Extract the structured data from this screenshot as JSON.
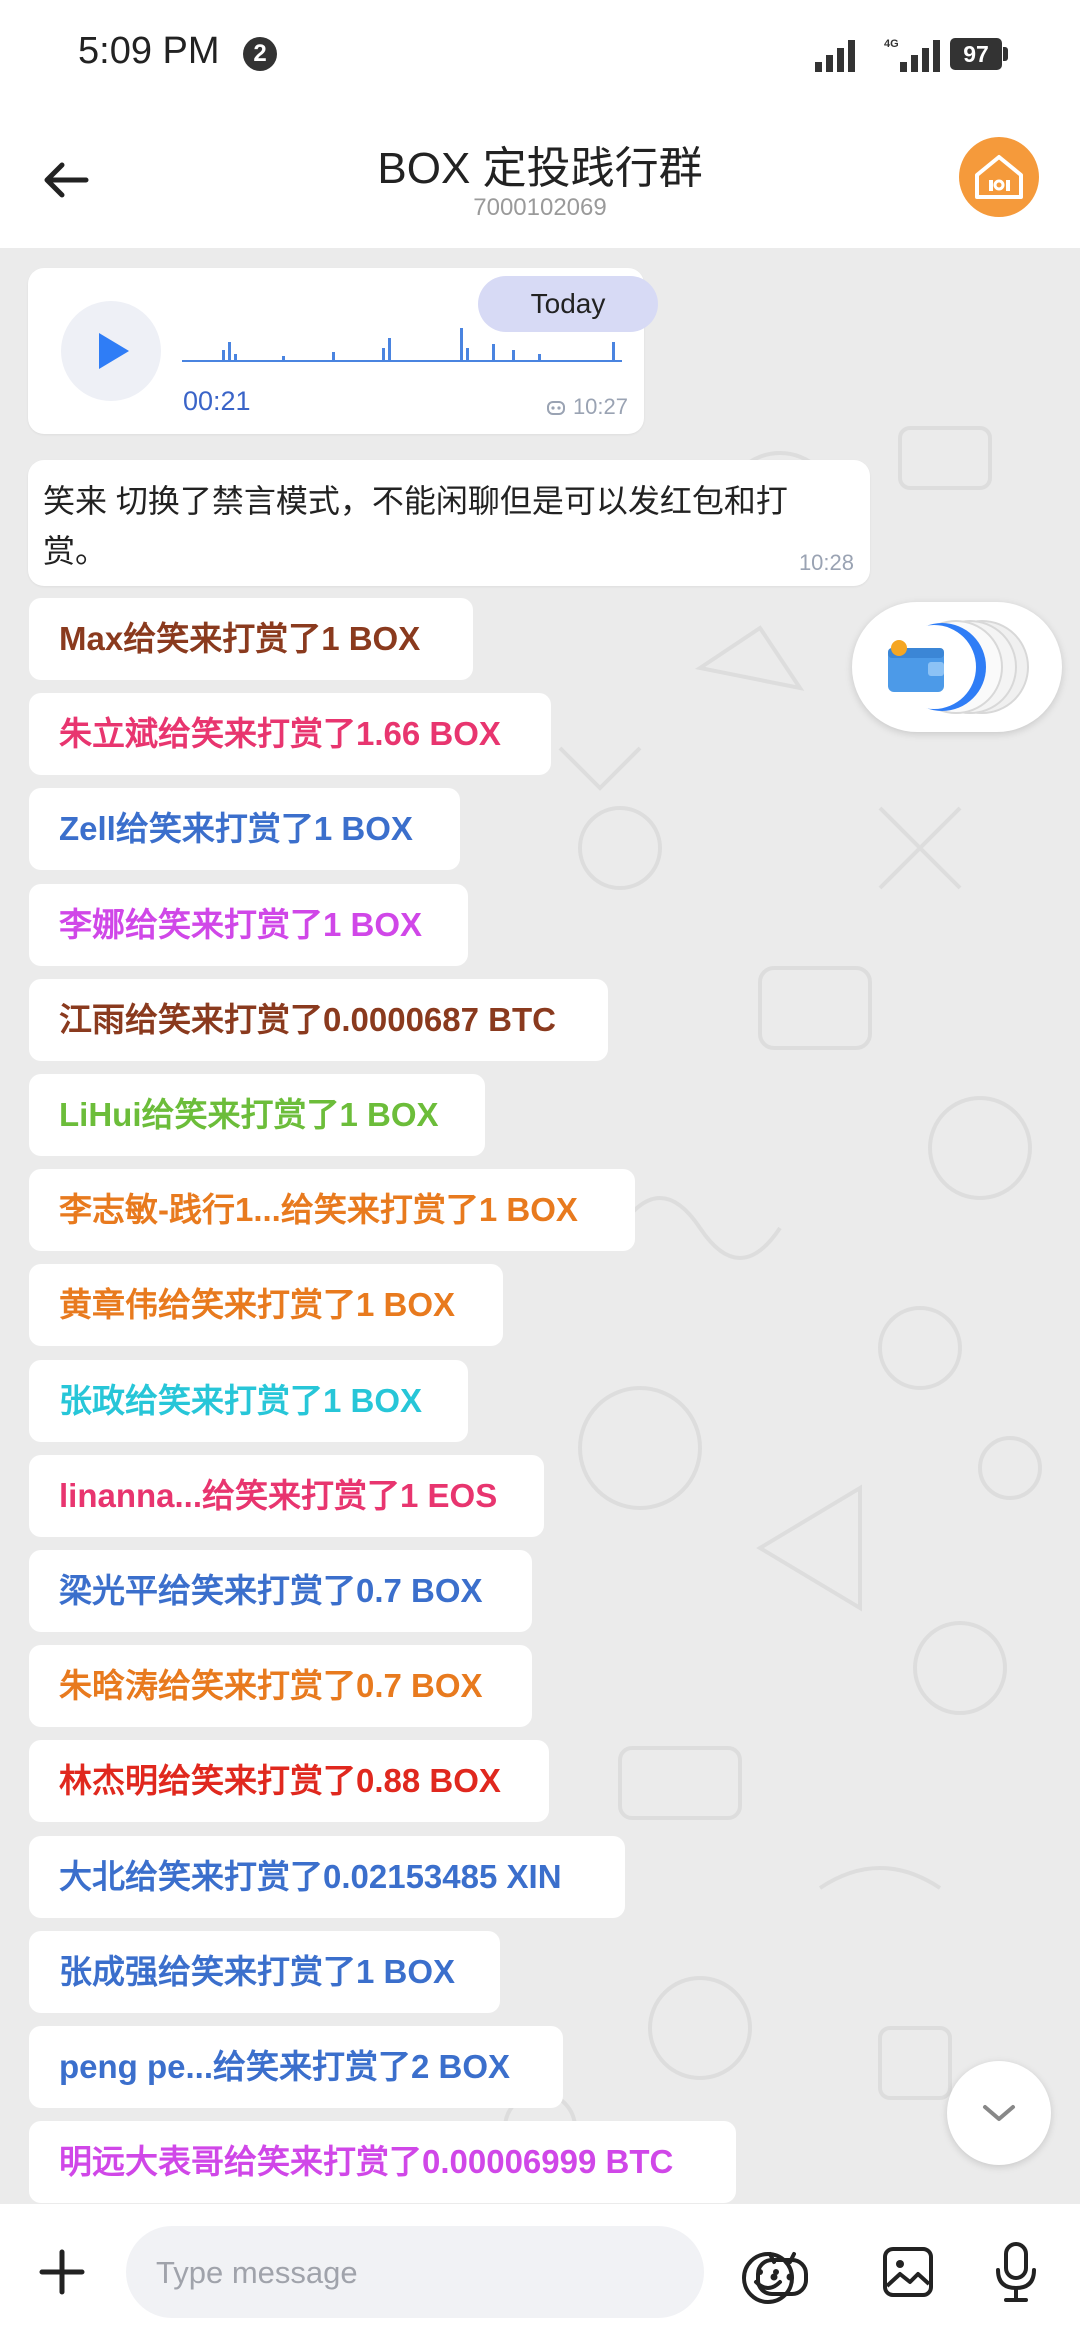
{
  "status_bar": {
    "time": "5:09 PM",
    "notification_count": "2",
    "network_label": "4G",
    "battery": "97"
  },
  "header": {
    "title": "BOX 定投践行群",
    "chat_id": "7000102069",
    "back_icon": "arrow-left-icon",
    "avatar_icon": "home-icon"
  },
  "voice_message": {
    "duration": "00:21",
    "time": "10:27",
    "date_pill": "Today"
  },
  "system_message": {
    "text": "笑来 切换了禁言模式，不能闲聊但是可以发红包和打赏。",
    "time": "10:28"
  },
  "rewards": [
    {
      "text": "Max给笑来打赏了1 BOX",
      "color": "#8a3a1e"
    },
    {
      "text": "朱立斌给笑来打赏了1.66 BOX",
      "color": "#e8356f"
    },
    {
      "text": "Zell给笑来打赏了1 BOX",
      "color": "#3b6fcc"
    },
    {
      "text": "李娜给笑来打赏了1 BOX",
      "color": "#d047e8"
    },
    {
      "text": "江雨给笑来打赏了0.0000687 BTC",
      "color": "#8a3a1e"
    },
    {
      "text": "LiHui给笑来打赏了1 BOX",
      "color": "#6cbd3a"
    },
    {
      "text": "李志敏-践行1...给笑来打赏了1 BOX",
      "color": "#e87a1e"
    },
    {
      "text": "黄章伟给笑来打赏了1 BOX",
      "color": "#e87a1e"
    },
    {
      "text": "张政给笑来打赏了1 BOX",
      "color": "#27c6d8"
    },
    {
      "text": "linanna...给笑来打赏了1 EOS",
      "color": "#e8356f"
    },
    {
      "text": "梁光平给笑来打赏了0.7 BOX",
      "color": "#3b6fcc"
    },
    {
      "text": "朱晗涛给笑来打赏了0.7 BOX",
      "color": "#e87a1e"
    },
    {
      "text": "林杰明给笑来打赏了0.88 BOX",
      "color": "#e0281e"
    },
    {
      "text": "大北给笑来打赏了0.02153485 XIN",
      "color": "#3b6fcc"
    },
    {
      "text": "张成强给笑来打赏了1 BOX",
      "color": "#3b6fcc"
    },
    {
      "text": "peng pe...给笑来打赏了2 BOX",
      "color": "#3b6fcc"
    },
    {
      "text": "明远大表哥给笑来打赏了0.00006999 BTC",
      "color": "#d047e8"
    }
  ],
  "input_bar": {
    "placeholder": "Type message"
  },
  "icons": {
    "plus": "plus-icon",
    "emoji": "emoji-icon",
    "bot": "bot-icon",
    "image": "image-icon",
    "mic": "microphone-icon",
    "wallet": "wallet-icon",
    "scroll": "chevron-down-icon"
  }
}
